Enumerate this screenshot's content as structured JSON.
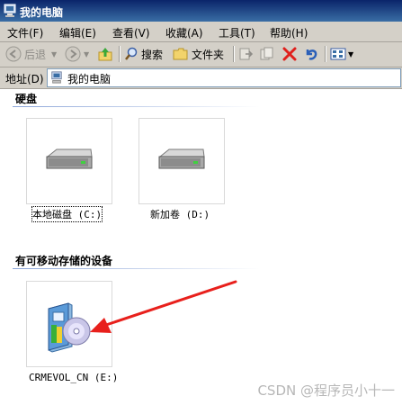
{
  "window": {
    "title": "我的电脑"
  },
  "menu": [
    "文件(F)",
    "编辑(E)",
    "查看(V)",
    "收藏(A)",
    "工具(T)",
    "帮助(H)"
  ],
  "toolbar": {
    "back": "后退",
    "search": "搜索",
    "folders": "文件夹"
  },
  "address": {
    "label": "地址(D)",
    "value": "我的电脑"
  },
  "groups": [
    {
      "title": "硬盘",
      "items": [
        "本地磁盘 (C:)",
        "新加卷 (D:)"
      ]
    },
    {
      "title": "有可移动存储的设备",
      "items": [
        "CRMEVOL_CN (E:)"
      ]
    }
  ],
  "watermark": "CSDN @程序员小十一",
  "colors": {
    "titlebar": "#0a246a",
    "arrow": "#e8201c",
    "chrome": "#d4d0c8"
  }
}
